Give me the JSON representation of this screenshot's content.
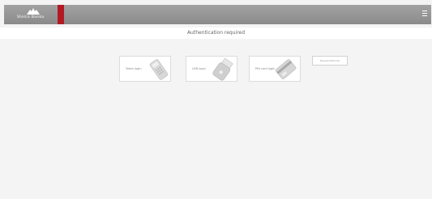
{
  "header": {
    "logo_text": "Stelco Banka",
    "accent_color": "#b21a23",
    "menu_icon": "hamburger-icon"
  },
  "page": {
    "title": "Authentication required"
  },
  "login_options": [
    {
      "label": "Token login",
      "icon": "token-icon"
    },
    {
      "label": "USB login",
      "icon": "usb-icon"
    },
    {
      "label": "PIN card login",
      "icon": "pin-card-icon"
    }
  ],
  "alternative_button": {
    "label": "Bypass/Alternat"
  }
}
